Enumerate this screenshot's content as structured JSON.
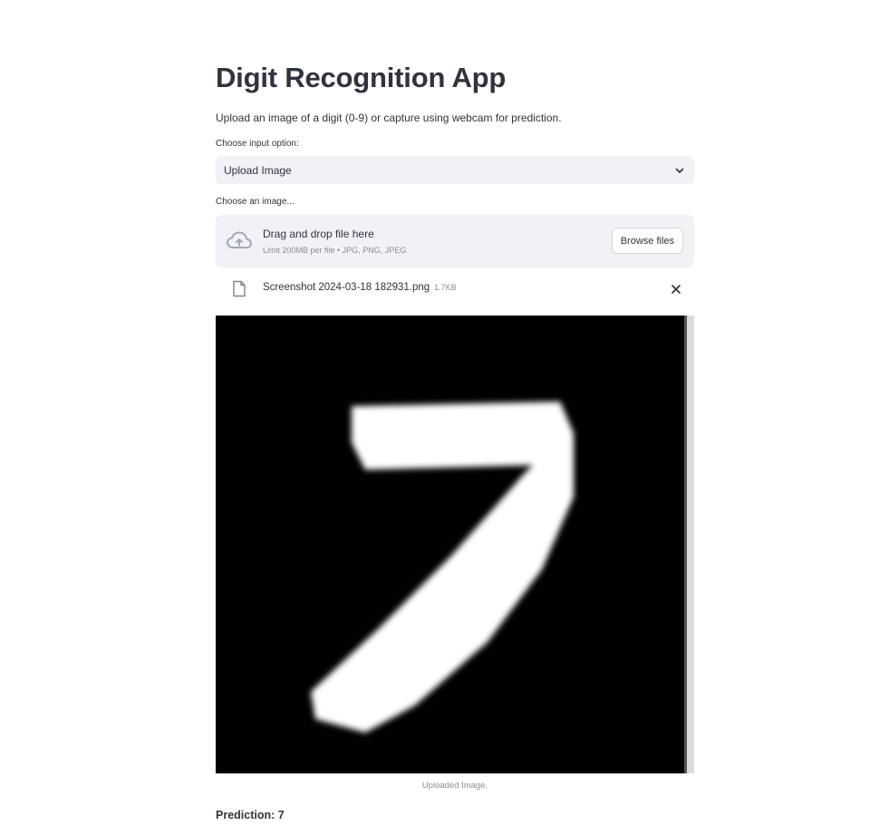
{
  "app": {
    "title": "Digit Recognition App",
    "description": "Upload an image of a digit (0-9) or capture using webcam for prediction."
  },
  "input_option": {
    "label": "Choose input option:",
    "selected": "Upload Image"
  },
  "uploader": {
    "label": "Choose an image...",
    "drag_text": "Drag and drop file here",
    "limit_text": "Limit 200MB per file • JPG, PNG, JPEG",
    "browse_label": "Browse files",
    "file_name": "Screenshot 2024-03-18 182931.png",
    "file_size": "1.7KB"
  },
  "image": {
    "caption": "Uploaded Image.",
    "depicted_digit": "7"
  },
  "result": {
    "prediction_text": "Prediction: 7"
  },
  "colors": {
    "text": "#31333f",
    "muted": "#8a8d96",
    "input_bg": "#f0f2f6",
    "icon": "#a3a8b8"
  },
  "icons": [
    "chevron-down-icon",
    "cloud-upload-icon",
    "file-icon",
    "close-icon"
  ]
}
